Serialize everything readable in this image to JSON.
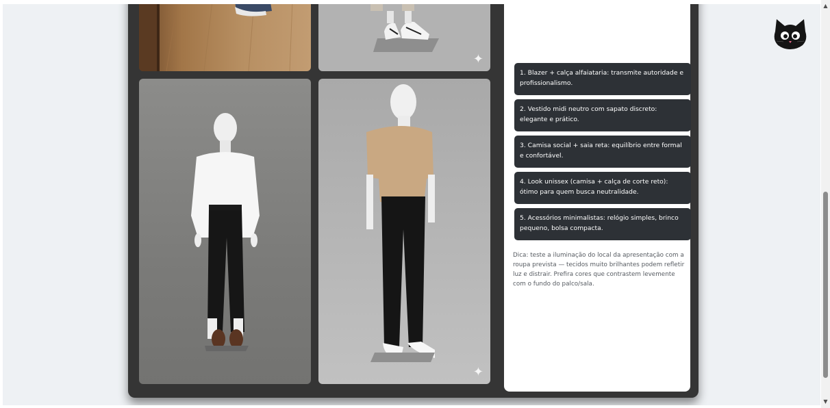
{
  "scrollbar": {
    "up_icon": "▲",
    "down_icon": "▼"
  },
  "gallery": {
    "images": [
      {
        "name": "mannequin-wood-floor-photo",
        "sparkle": ""
      },
      {
        "name": "mannequin-sneakers-photo",
        "sparkle": "✦"
      },
      {
        "name": "mannequin-white-shirt-photo",
        "sparkle": ""
      },
      {
        "name": "mannequin-beige-polo-photo",
        "sparkle": "✦"
      }
    ]
  },
  "panel": {
    "items": [
      "1. Blazer + calça alfaiataria: transmite autoridade e profissionalismo.",
      "2. Vestido midi neutro com sapato discreto: elegante e prático.",
      "3. Camisa social + saia reta: equilíbrio entre formal e confortável.",
      "4. Look unissex (camisa + calça de corte reto): ótimo para quem busca neutralidade.",
      "5. Acessórios minimalistas: relógio simples, brinco pequeno, bolsa compacta."
    ],
    "tip": "Dica: teste a iluminação do local da apresentação com a roupa prevista — tecidos muito brilhantes podem refletir luz e distrair. Prefira cores que contrastem levemente com o fundo do palco/sala."
  },
  "colors": {
    "page_bg": "#eef1f4",
    "card_bg": "#353535",
    "item_bg": "#2d3136"
  },
  "icons": {
    "cat": "cat-face-icon"
  }
}
